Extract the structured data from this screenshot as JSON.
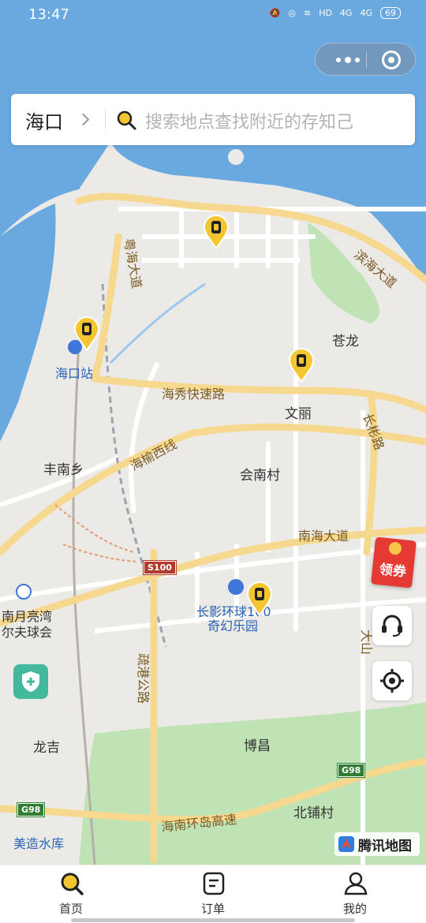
{
  "status_bar": {
    "time": "13:47",
    "hd": "HD",
    "net1": "4G",
    "net2": "4G",
    "battery": "69"
  },
  "search": {
    "city": "海口",
    "placeholder": "搜索地点查找附近的存知己"
  },
  "map": {
    "places": {
      "haikou_station": "海口站",
      "canglong": "苍龙",
      "wenli": "文丽",
      "fengnan": "丰南乡",
      "huinan": "会南村",
      "nanyue": "南月亮湾",
      "golf": "尔夫球会",
      "changying": "长影环球100",
      "qihuan": "奇幻乐园",
      "bochang": "博昌",
      "longji": "龙吉",
      "beipu": "北铺村",
      "meizao": "美造水库"
    },
    "roads": {
      "yuehai": "粤海大道",
      "binhai": "滨海大道",
      "haixiu": "海秀快速路",
      "changbin": "长彬路",
      "haiyu": "海榆西线",
      "nanhai": "南海大道",
      "shugang": "疏港公路",
      "ring": "海南环岛高速",
      "dashan": "大山"
    },
    "shields": {
      "s100": "S100",
      "g98_right": "G98",
      "g98_left": "G98"
    },
    "brand": "腾讯地图",
    "colors": {
      "water": "#6aa8e0",
      "land": "#eceae6",
      "park": "#bfe3b5",
      "road_major": "#f6d88f",
      "pin": "#f3c530"
    }
  },
  "widgets": {
    "coupon_label": "领券"
  },
  "tabbar": {
    "tabs": [
      {
        "label": "首页",
        "icon": "search-icon"
      },
      {
        "label": "订单",
        "icon": "order-icon"
      },
      {
        "label": "我的",
        "icon": "user-icon"
      }
    ]
  }
}
